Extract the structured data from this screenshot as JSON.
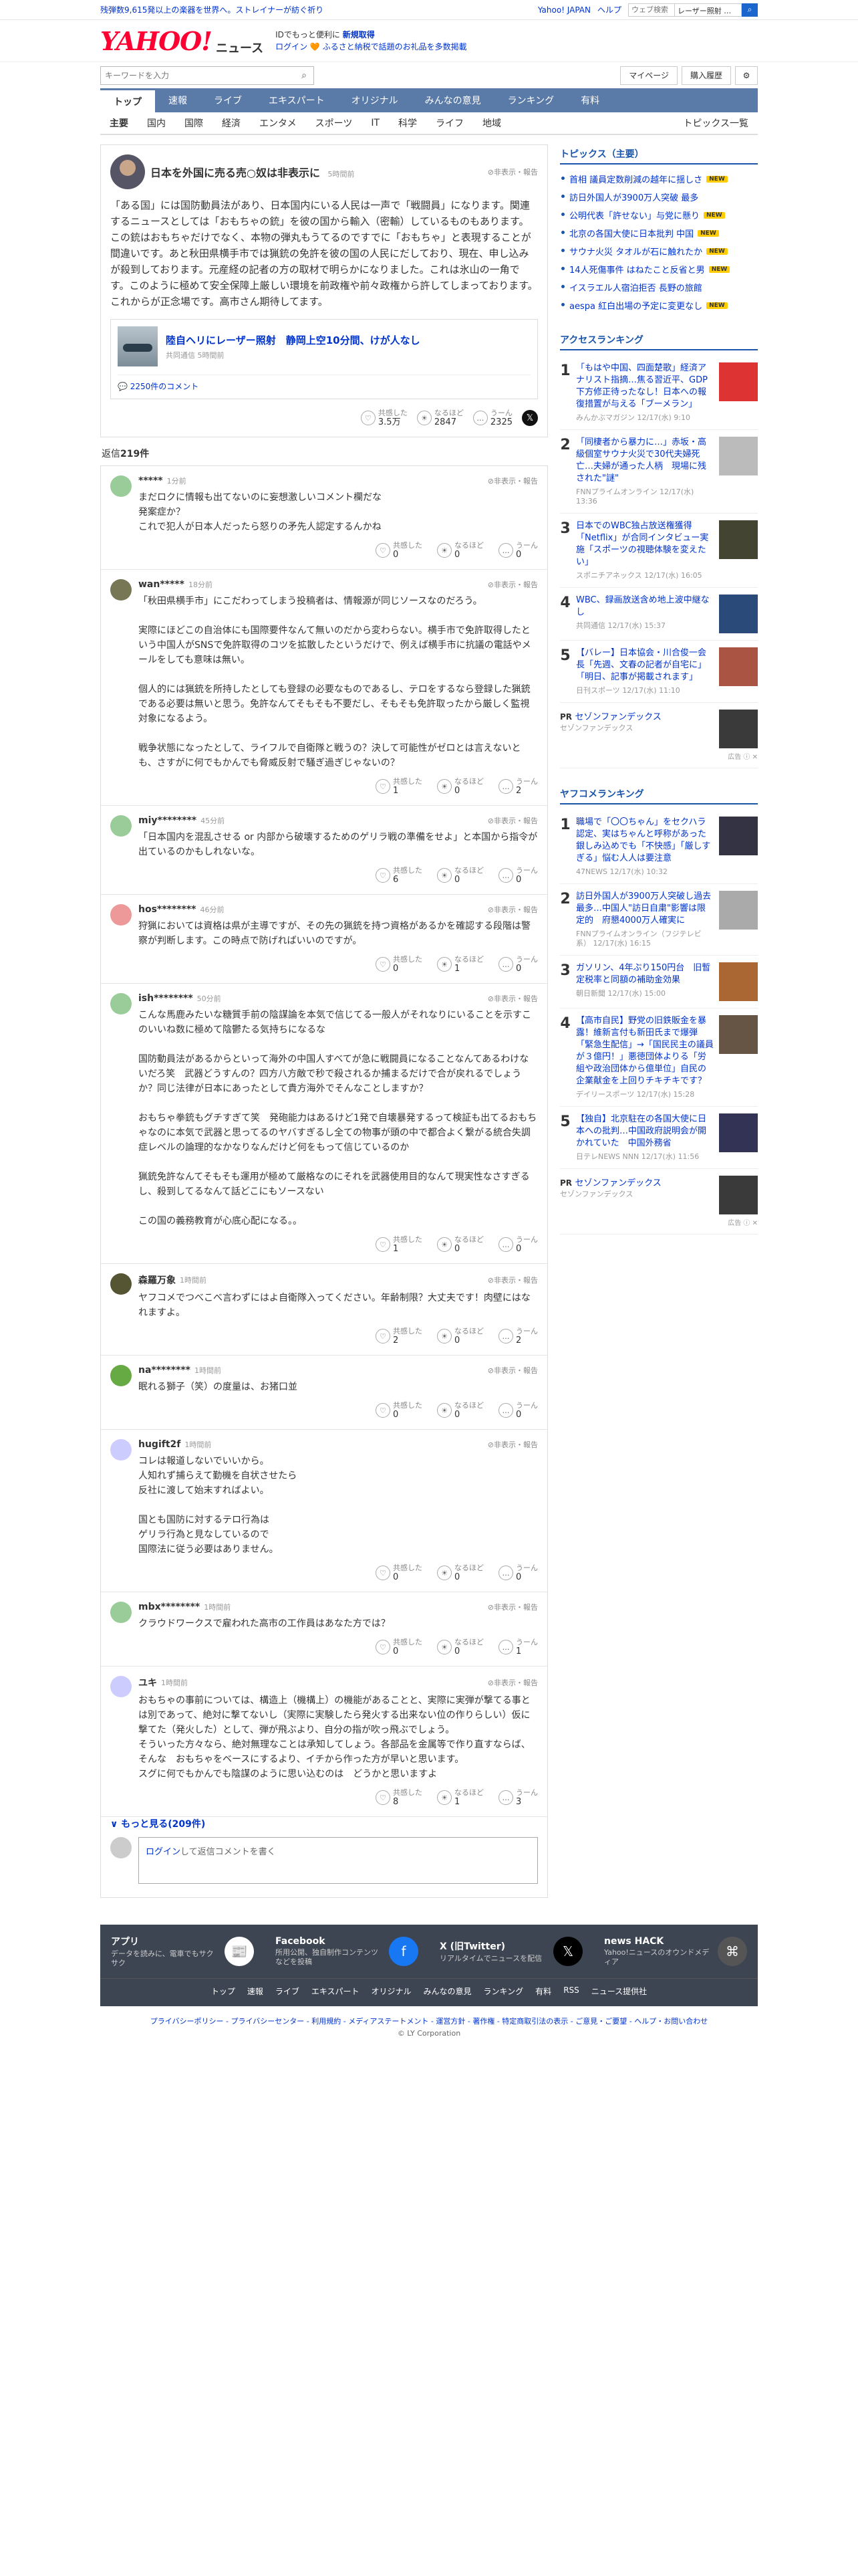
{
  "topbar": {
    "promo": "残弾数9,615発以上の楽器を世界へ。ストレイナーが紡ぐ祈り",
    "links": [
      "Yahoo! JAPAN",
      "ヘルプ"
    ],
    "search_placeholder": "ウェブ検索",
    "search_term": "レーザー照射 …"
  },
  "header": {
    "logo": "YAHOO!",
    "logo_sub": "JAPAN",
    "news_label": "ニュース",
    "line1_prefix": "IDでもっと便利に",
    "line1_link": "新規取得",
    "line2": "ログイン 🧡 ふるさと納税で話題のお礼品を多数掲載"
  },
  "search": {
    "placeholder": "キーワードを入力",
    "buttons": [
      "マイページ",
      "購入履歴"
    ]
  },
  "mainnav": [
    "トップ",
    "速報",
    "ライブ",
    "エキスパート",
    "オリジナル",
    "みんなの意見",
    "ランキング",
    "有料"
  ],
  "subnav": [
    "主要",
    "国内",
    "国際",
    "経済",
    "エンタメ",
    "スポーツ",
    "IT",
    "科学",
    "ライフ",
    "地域"
  ],
  "subnav_right": "トピックス一覧",
  "article": {
    "title": "日本を外国に売る売○奴は非表示に",
    "time": "5時間前",
    "hide": "非表示・報告",
    "body": "「ある国」には国防動員法があり、日本国内にいる人民は一声で「戦闘員」になります。関連するニュースとしては「おもちゃの銃」を彼の国から輸入（密輸）しているものもあります。この銃はおもちゃだけでなく、本物の弾丸もうてるのですでに「おもちゃ」と表現することが間違いです。あと秋田県横手市では猟銃の免許を彼の国の人民にだしており、現在、申し込みが殺到しております。元産経の記者の方の取材で明らかになりました。これは氷山の一角です。このように極めて安全保障上厳しい環境を前政権や前々政権から許してしまっております。これからが正念場です。高市さん期待してます。",
    "link": {
      "title": "陸自ヘリにレーザー照射　静岡上空10分間、けが人なし",
      "meta": "共同通信  5時間前",
      "comments": "2250件のコメント"
    },
    "reactions": [
      {
        "label": "共感した",
        "count": "3.5万",
        "icon": "heart-icon"
      },
      {
        "label": "なるほど",
        "count": "2847",
        "icon": "lightbulb-icon"
      },
      {
        "label": "うーん",
        "count": "2325",
        "icon": "hmm-icon"
      }
    ]
  },
  "reply_count_prefix": "返信",
  "reply_count": "219件",
  "comments": [
    {
      "user": "*****",
      "time": "1分前",
      "color": "#9c9",
      "text": "まだロクに情報も出てないのに妄想激しいコメント欄だな\n発案症か？\nこれで犯人が日本人だったら怒りの矛先人認定するんかね",
      "r": [
        "0",
        "0",
        "0"
      ]
    },
    {
      "user": "wan*****",
      "time": "18分前",
      "color": "#775",
      "text": "「秋田県横手市」にこだわってしまう投稿者は、情報源が同じソースなのだろう。\n\n実際にほどこの自治体にも国際要件なんて無いのだから変わらない。横手市で免許取得したという中国人がSNSで免許取得のコツを拡散したというだけで、例えば横手市に抗議の電話やメールをしても意味は無い。\n\n個人的には猟銃を所持したとしても登録の必要なものであるし、テロをするなら登録した猟銃である必要は無いと思う。免許なんてそもそも不要だし、そもそも免許取ったから厳しく監視対象になるよう。\n\n戦争状態になったとして、ライフルで自衛隊と戦うの？決して可能性がゼロとは言えないとも、さすがに何でもかんでも脅威反射で騒ぎ過ぎじゃないの？",
      "r": [
        "1",
        "0",
        "2"
      ]
    },
    {
      "user": "miy********",
      "time": "45分前",
      "color": "#9c9",
      "text": "「日本国内を混乱させる or 内部から破壊するためのゲリラ戦の準備をせよ」と本国から指令が出ているのかもしれないな。",
      "r": [
        "6",
        "0",
        "0"
      ]
    },
    {
      "user": "hos********",
      "time": "46分前",
      "color": "#e99",
      "text": "狩猟においては資格は県が主導ですが、その先の猟銃を持つ資格があるかを確認する段階は警察が判断します。この時点で防げればいいのですが。",
      "r": [
        "0",
        "1",
        "0"
      ]
    },
    {
      "user": "ish********",
      "time": "50分前",
      "color": "#9c9",
      "text": "こんな馬鹿みたいな糖質手前の陰謀論を本気で信じてる一般人がそれなりにいることを示すこのいいね数に極めて陰鬱たる気持ちになるな\n\n国防動員法があるからといって海外の中国人すべてが急に戦闘員になることなんてあるわけないだろ笑　武器どうすんの？四方八方敵で秒で殺されるか捕まるだけで合が戻れるでしょうか？同じ法律が日本にあったとして貴方海外でそんなことしますか？\n\nおもちゃ拳銃もグチすぎて笑　発砲能力はあるけど1発で自壊暴発するって検証も出てるおもちゃなのに本気で武器と思ってるのヤバすぎるし全ての物事が頭の中で都合よく繋がる統合失調症レベルの論理的なかなりなんだけど何をもって信じているのか\n\n猟銃免許なんてそもそも運用が極めて厳格なのにそれを武器使用目的なんて現実性なさすぎるし、殺到してるなんて話どこにもソースない\n\nこの国の義務教育が心底心配になる。。",
      "r": [
        "1",
        "0",
        "0"
      ]
    },
    {
      "user": "森羅万象",
      "time": "1時間前",
      "color": "#553",
      "text": "ヤフコメでつべこべ言わずにはよ自衛隊入ってください。年齢制限？大丈夫です！肉壁にはなれますよ。",
      "r": [
        "2",
        "0",
        "2"
      ]
    },
    {
      "user": "na********",
      "time": "1時間前",
      "color": "#6a4",
      "text": "眠れる獅子（笑）の度量は、お猪口並",
      "r": [
        "0",
        "0",
        "0"
      ]
    },
    {
      "user": "hugift2f",
      "time": "1時間前",
      "color": "#ccf",
      "text": "コレは報道しないでいいから。\n人知れず捕らえて勤機を自状させたら\n反社に渡して始末すればよい。\n\n国とも国防に対するテロ行為は\nゲリラ行為と見なしているので\n国際法に従う必要はありません。",
      "r": [
        "0",
        "0",
        "0"
      ]
    },
    {
      "user": "mbx********",
      "time": "1時間前",
      "color": "#9c9",
      "text": "クラウドワークスで雇われた高市の工作員はあなた方では？",
      "r": [
        "0",
        "0",
        "1"
      ]
    },
    {
      "user": "ユキ",
      "time": "1時間前",
      "color": "#ccf",
      "text": "おもちゃの事前については、構造上（機構上）の機能があることと、実際に実弾が撃てる事とは別であって、絶対に撃てないし（実際に実験したら発火する出来ない位の作りらしい）仮に撃てた（発火した）として、弾が飛ぶより、自分の指が吹っ飛ぶでしょう。\nそういった方々なら、絶対無理なことは承知してしょう。各部品を金属等で作り直すならば、そんな　おもちゃをベースにするより、イチから作った方が早いと思います。\nスグに何でもかんでも陰謀のように思い込むのは　どうかと思いますよ",
      "r": [
        "8",
        "1",
        "3"
      ]
    }
  ],
  "comment_labels": {
    "hide": "非表示・報告",
    "r1": "共感した",
    "r2": "なるほど",
    "r3": "うーん"
  },
  "more_link": "もっと見る(209件)",
  "reply_form": {
    "login": "ログイン",
    "text": "して返信コメントを書く"
  },
  "side": {
    "topics_title": "トピックス（主要）",
    "topics": [
      {
        "text": "首相 議員定数削減の越年に揺しさ",
        "new": true
      },
      {
        "text": "訪日外国人が3900万人突破 最多",
        "new": false
      },
      {
        "text": "公明代表「許せない」与党に懸り",
        "new": true
      },
      {
        "text": "北京の各国大使に日本批判 中国",
        "new": true
      },
      {
        "text": "サウナ火災 タオルが石に触れたか",
        "new": true
      },
      {
        "text": "14人死傷事件 はねたこと反省と男",
        "new": true
      },
      {
        "text": "イスラエル人宿泊拒否 長野の旅館",
        "new": false
      },
      {
        "text": "aespa 紅白出場の予定に変更なし",
        "new": true
      }
    ],
    "new_badge": "NEW",
    "access_title": "アクセスランキング",
    "access": [
      {
        "text": "「もはや中国、四面楚歌」経済アナリスト指摘…焦る習近平、GDP下方修正待ったなし！日本への報復措置が与える「ブーメラン」",
        "meta": "みんかぶマガジン  12/17(水) 9:10",
        "color": "#d33"
      },
      {
        "text": "「同棲者から暴力に…」赤坂・高級個室サウナ火災で30代夫婦死亡…夫婦が通った人柄　現場に残された\"謎\"",
        "meta": "FNNプライムオンライン  12/17(水) 13:36",
        "color": "#bbb"
      },
      {
        "text": "日本でのWBC独占放送権獲得「Netflix」が合同インタビュー実施「スポーツの視聴体験を変えたい」",
        "meta": "スポニチアネックス  12/17(水) 16:05",
        "color": "#443"
      },
      {
        "text": "WBC、録画放送含め地上波中継なし",
        "meta": "共同通信  12/17(水) 15:37",
        "color": "#2a4a7a"
      },
      {
        "text": "【バレー】日本協会・川合俊一会長「先週、文春の記者が自宅に」「明日、記事が掲載されます」",
        "meta": "日刊スポーツ  12/17(水) 11:10",
        "color": "#a54"
      }
    ],
    "pr1": {
      "badge": "PR",
      "title": "セゾンファンデックス",
      "sub": "セゾンファンデックス"
    },
    "ad": "広告",
    "yafukome_title": "ヤフコメランキング",
    "yafukome": [
      {
        "text": "職場で「〇〇ちゃん」をセクハラ認定、実はちゃんと呼称があった銀しみ込めでも「不快感」「厳しすぎる」悩む人人は要注意",
        "meta": "47NEWS  12/17(水) 10:32",
        "color": "#334"
      },
      {
        "text": "訪日外国人が3900万人突破し過去最多…中国人\"訪日自粛\"影響は限定的　府懇4000万人確実に",
        "meta": "FNNプライムオンライン（フジテレビ系）  12/17(水) 16:15",
        "color": "#aaa"
      },
      {
        "text": "ガソリン、4年ぶり150円台　旧暫定税率と同額の補助金効果",
        "meta": "朝日新聞  12/17(水) 15:00",
        "color": "#a63"
      },
      {
        "text": "【高市自民】野党の旧鉄販金を暴露！維新言付も新田氏まで爆弾「緊急生配信」→「国民民主の議員が３億円！」悪徳団体よりる「労組や政治団体から億単位」自民の企業献金を上回りチキチキです？",
        "meta": "デイリースポーツ  12/17(水) 15:28",
        "color": "#654"
      },
      {
        "text": "【独自】北京駐在の各国大使に日本への批判…中国政府説明会が開かれていた　中国外務省",
        "meta": "日テレNEWS NNN  12/17(水) 11:56",
        "color": "#335"
      }
    ],
    "pr2": {
      "badge": "PR",
      "title": "セゾンファンデックス",
      "sub": "セゾンファンデックス"
    }
  },
  "footer": {
    "apps": [
      {
        "title": "アプリ",
        "desc": "データを読みに、電車でもサクサク",
        "icon": "app-icon",
        "bg": "#fff",
        "fg": "#ff0033",
        "glyph": "📰"
      },
      {
        "title": "Facebook",
        "desc": "所用公開、独自制作コンテンツなどを投稿",
        "icon": "facebook-icon",
        "bg": "#1877f2",
        "fg": "#fff",
        "glyph": "f"
      },
      {
        "title": "X (旧Twitter)",
        "desc": "リアルタイムでニュースを配信",
        "icon": "x-icon",
        "bg": "#000",
        "fg": "#fff",
        "glyph": "𝕏"
      },
      {
        "title": "news HACK",
        "desc": "Yahoo!ニュースのオウンドメディア",
        "icon": "newshack-icon",
        "bg": "#555",
        "fg": "#fff",
        "glyph": "⌘"
      }
    ],
    "nav": [
      "トップ",
      "速報",
      "ライブ",
      "エキスパート",
      "オリジナル",
      "みんなの意見",
      "ランキング",
      "有料",
      "RSS",
      "ニュース提供社"
    ],
    "links": "プライバシーポリシー - プライバシーセンター - 利用規約 - メディアステートメント - 運営方針 - 著作権 - 特定商取引法の表示 - ご意見・ご要望 - ヘルプ・お問い合わせ",
    "copyright": "© LY Corporation"
  }
}
